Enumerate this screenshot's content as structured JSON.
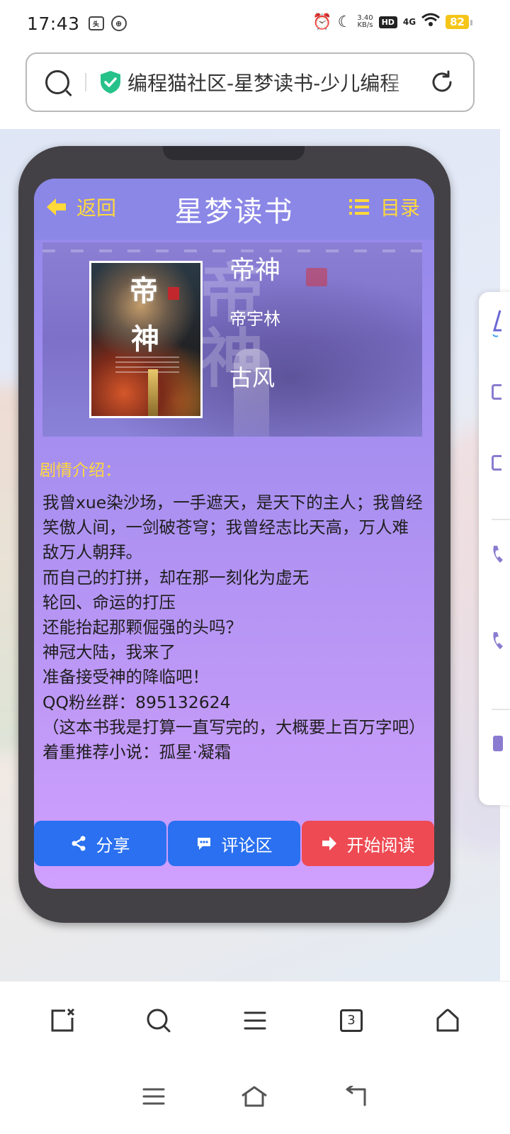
{
  "status_bar": {
    "time": "17:43",
    "net_speed_value": "3.40",
    "net_speed_unit": "KB/s",
    "hd_label": "HD",
    "network": "4G",
    "battery": "82"
  },
  "address_bar": {
    "url_text": "编程猫社区-星梦读书-少儿编程"
  },
  "app": {
    "back_label": "返回",
    "title": "星梦读书",
    "toc_label": "目录"
  },
  "book": {
    "title": "帝神",
    "author": "帝宇林",
    "genre": "古风",
    "cover_text_1": "帝",
    "cover_text_2": "神"
  },
  "synopsis": {
    "label": "剧情介绍：",
    "lines": [
      "我曾xue染沙场，一手遮天，是天下的主人；我曾经笑傲人间，一剑破苍穹；我曾经志比天高，万人难敌万人朝拜。",
      "而自己的打拼，却在那一刻化为虚无",
      "轮回、命运的打压",
      "还能抬起那颗倔强的头吗？",
      "神冠大陆，我来了",
      "准备接受神的降临吧！",
      "QQ粉丝群：895132624",
      "（这本书我是打算一直写完的，大概要上百万字吧）",
      "着重推荐小说：孤星·凝霜"
    ]
  },
  "actions": {
    "share": "分享",
    "comments": "评论区",
    "start_reading": "开始阅读"
  },
  "toolbar": {
    "tab_count": "3"
  },
  "colors": {
    "accent_yellow": "#ffd93a",
    "button_blue": "#2a70f0",
    "button_red": "#ee4a53",
    "header_purple": "#8b87e6"
  }
}
